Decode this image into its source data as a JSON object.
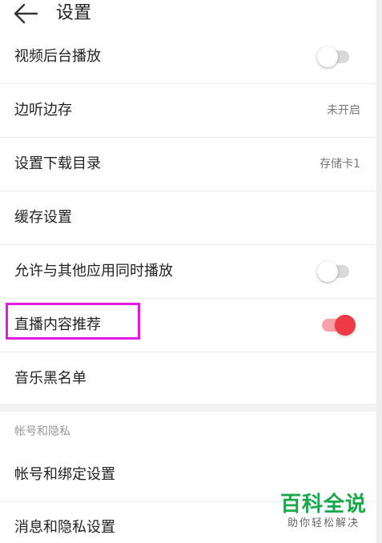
{
  "header": {
    "title": "设置",
    "back_icon": "arrow-left-icon"
  },
  "settings": {
    "video_background_play": {
      "label": "视频后台播放",
      "toggle_on": false
    },
    "play_while_caching": {
      "label": "边听边存",
      "value": "未开启"
    },
    "download_directory": {
      "label": "设置下载目录",
      "value": "存储卡1"
    },
    "cache_settings": {
      "label": "缓存设置"
    },
    "allow_mix_play": {
      "label": "允许与其他应用同时播放",
      "toggle_on": false
    },
    "live_recommend": {
      "label": "直播内容推荐",
      "toggle_on": true
    },
    "music_blacklist": {
      "label": "音乐黑名单"
    }
  },
  "account_section": {
    "title": "帐号和隐私",
    "items": [
      {
        "label": "帐号和绑定设置"
      },
      {
        "label": "消息和隐私设置"
      }
    ]
  },
  "watermark": {
    "main": "百科全说",
    "sub": "助你轻松解决"
  },
  "colors": {
    "toggle_on_knob": "#f03a47",
    "toggle_on_track": "#f7a2a6",
    "highlight": "#e21ae2",
    "watermark_green": "#1aa64a"
  }
}
